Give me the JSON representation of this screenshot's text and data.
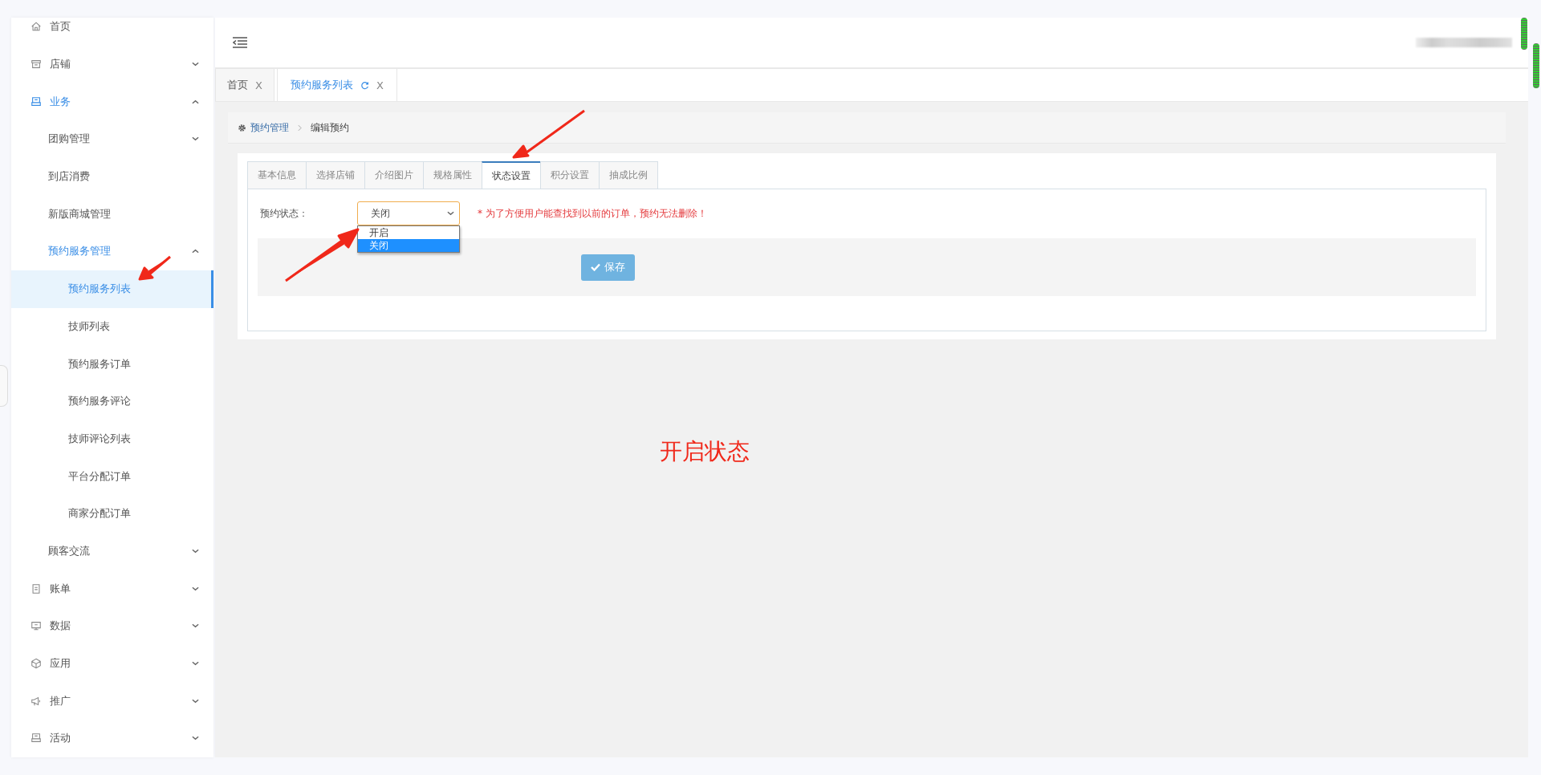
{
  "sidebar": {
    "items": [
      {
        "label": "首页"
      },
      {
        "label": "店铺",
        "expanded": false
      },
      {
        "label": "业务",
        "expanded": true,
        "children": [
          {
            "label": "团购管理",
            "expanded": false
          },
          {
            "label": "到店消费"
          },
          {
            "label": "新版商城管理"
          },
          {
            "label": "预约服务管理",
            "expanded": true,
            "children": [
              {
                "label": "预约服务列表",
                "selected": true
              },
              {
                "label": "技师列表",
                "selected": false
              },
              {
                "label": "预约服务订单",
                "selected": false
              },
              {
                "label": "预约服务评论",
                "selected": false
              },
              {
                "label": "技师评论列表",
                "selected": false
              },
              {
                "label": "平台分配订单",
                "selected": false
              },
              {
                "label": "商家分配订单",
                "selected": false
              }
            ]
          },
          {
            "label": "顾客交流",
            "expanded": false
          }
        ]
      },
      {
        "label": "账单",
        "expanded": false
      },
      {
        "label": "数据",
        "expanded": false
      },
      {
        "label": "应用",
        "expanded": false
      },
      {
        "label": "推广",
        "expanded": false
      },
      {
        "label": "活动",
        "expanded": false
      }
    ]
  },
  "page_tabs": [
    {
      "label": "首页",
      "selected": false,
      "close": "X"
    },
    {
      "label": "预约服务列表",
      "selected": true,
      "close": "X"
    }
  ],
  "breadcrumb": [
    {
      "label": "预约管理",
      "kind": "link"
    },
    {
      "label": "编辑预约",
      "kind": "current"
    }
  ],
  "form_tabs": [
    {
      "label": "基本信息",
      "selected": false
    },
    {
      "label": "选择店铺",
      "selected": false
    },
    {
      "label": "介绍图片",
      "selected": false
    },
    {
      "label": "规格属性",
      "selected": false
    },
    {
      "label": "状态设置",
      "selected": true
    },
    {
      "label": "积分设置",
      "selected": false
    },
    {
      "label": "抽成比例",
      "selected": false
    }
  ],
  "status_field": {
    "label": "预约状态：",
    "value": "关闭",
    "expanded": true,
    "options": [
      {
        "label": "开启",
        "selected": false
      },
      {
        "label": "关闭",
        "selected": true
      }
    ]
  },
  "note": "* 为了方便用户能查找到以前的订单，预约无法删除！",
  "save_button": "保存",
  "annotation": "开启状态"
}
